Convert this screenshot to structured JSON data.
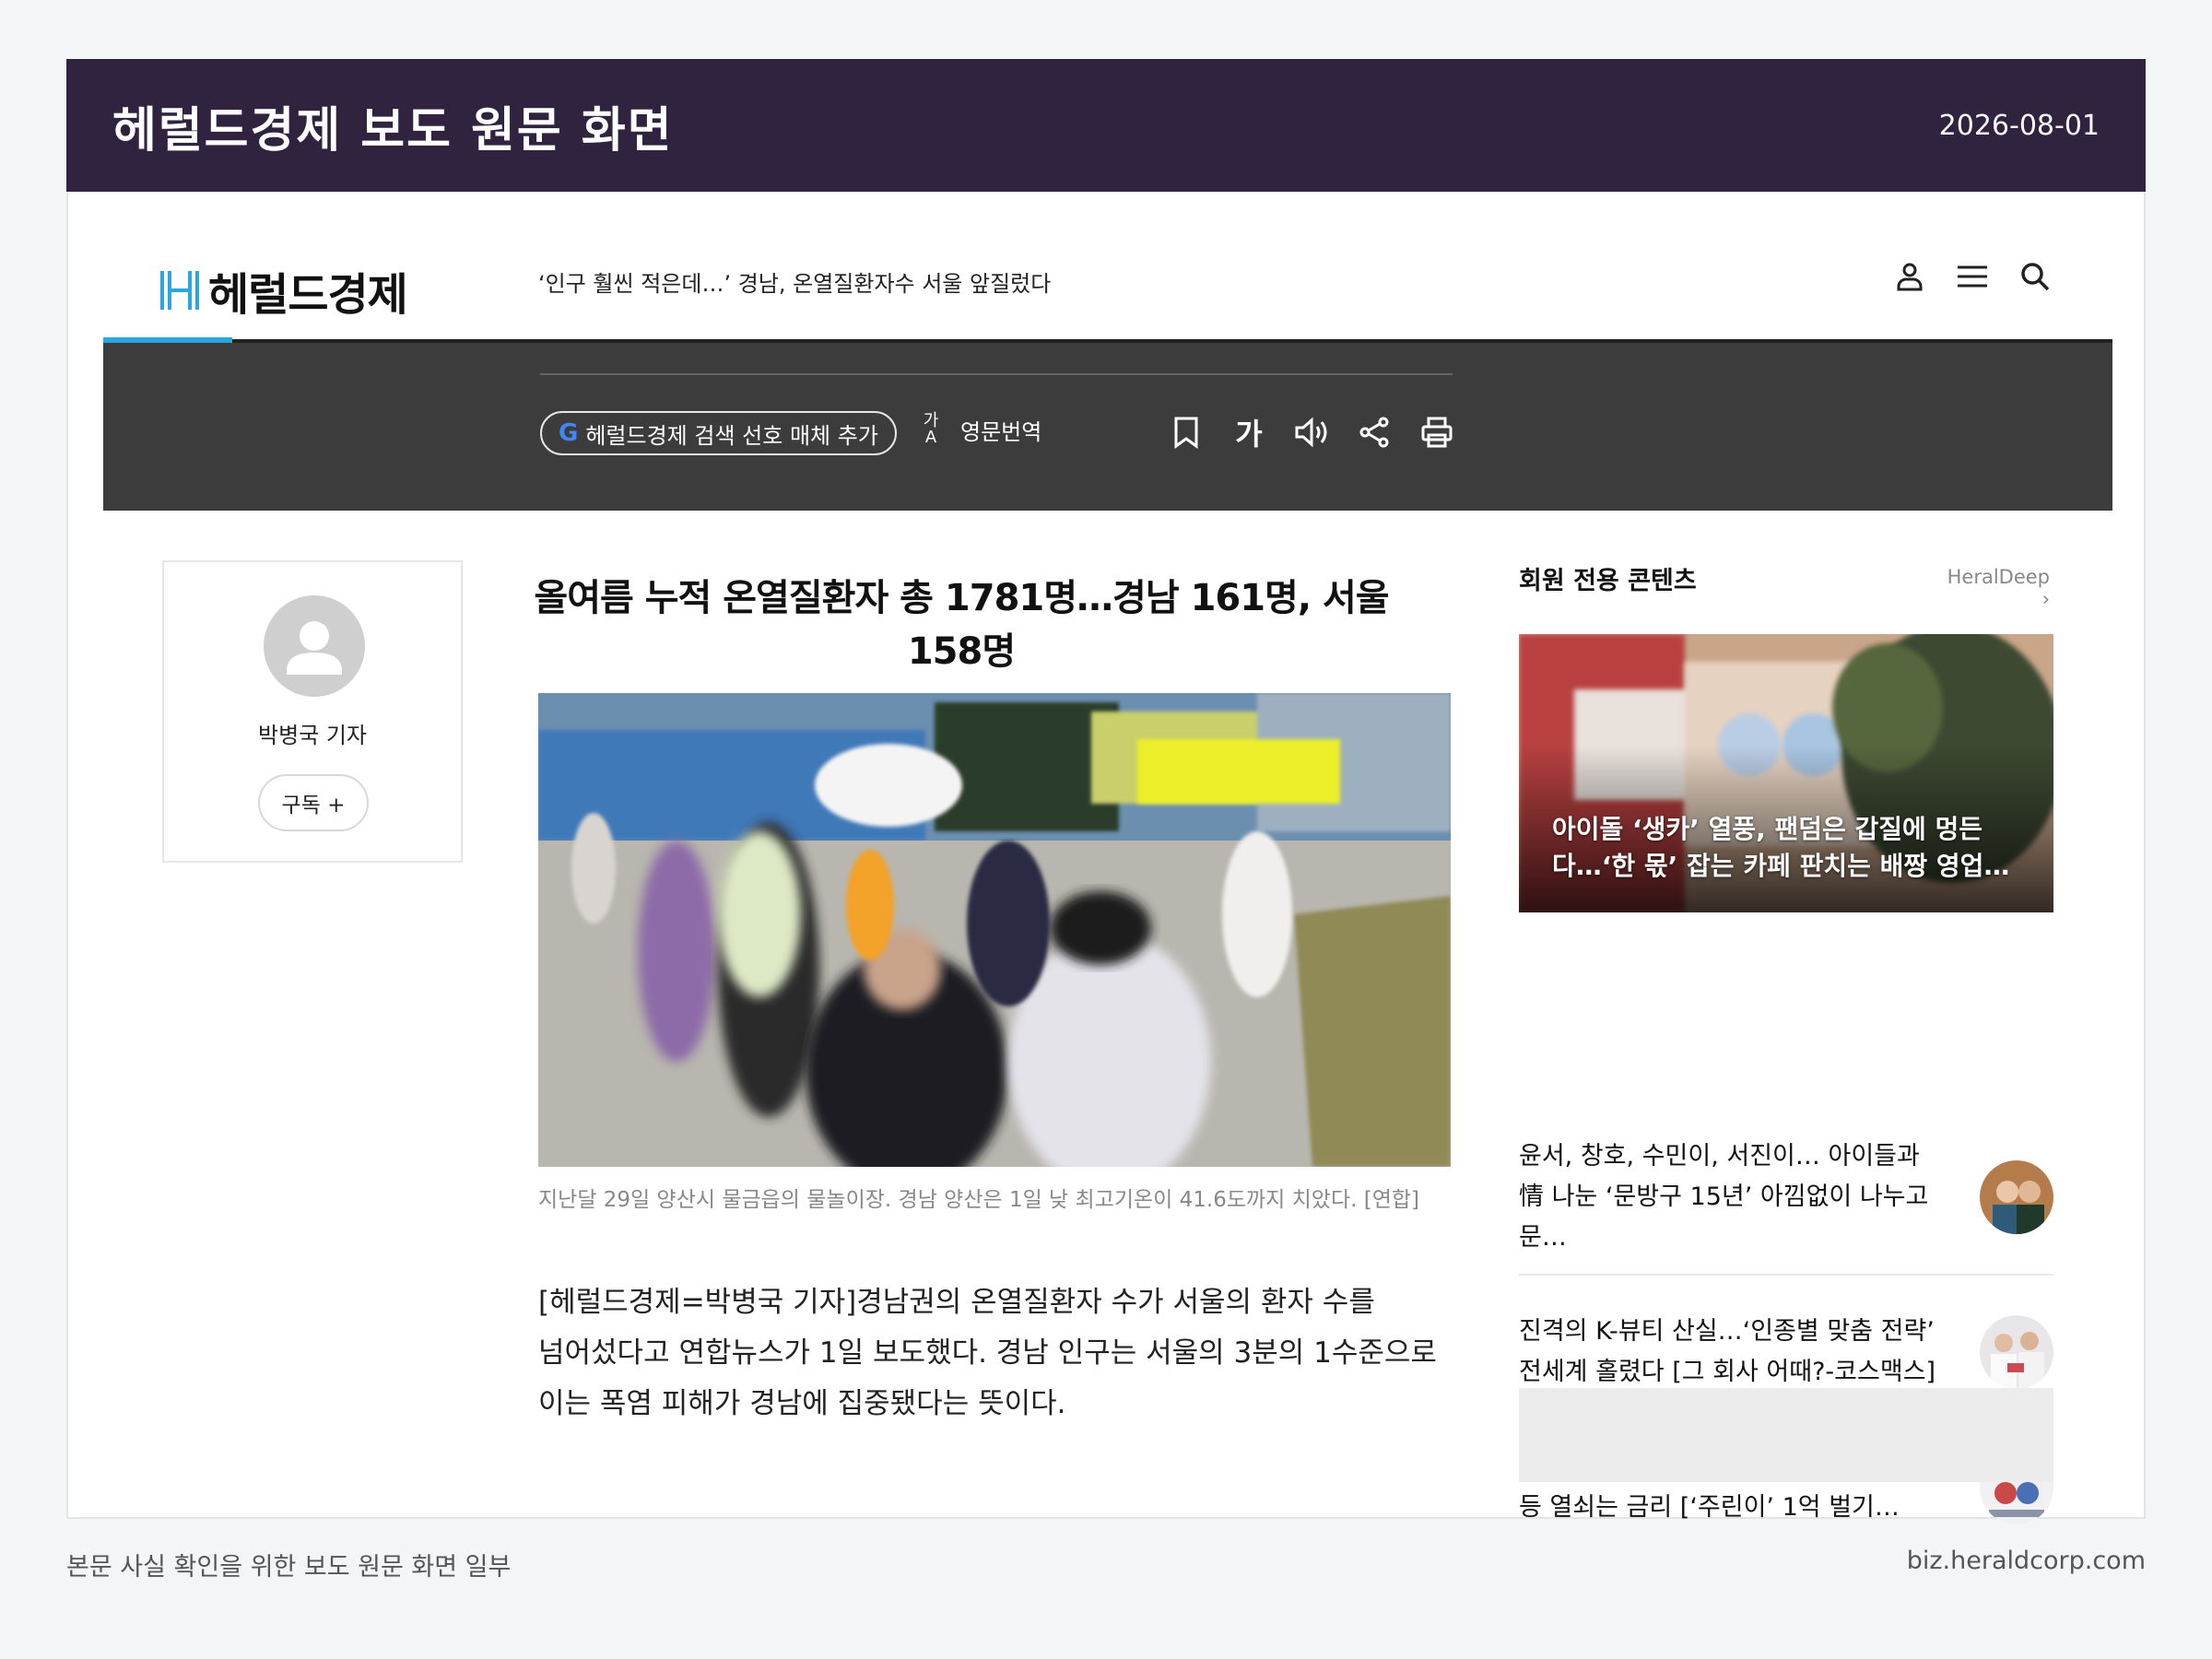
{
  "top_bar": {
    "title": "헤럴드경제 보도 원문 화면",
    "date": "2026-08-01"
  },
  "site": {
    "logo_text": "헤럴드경제",
    "ticker": "‘인구 훨씬 적은데…’ 경남, 온열질환자수 서울 앞질렀다",
    "icons": [
      "user-icon",
      "menu-icon",
      "search-icon"
    ]
  },
  "toolbar": {
    "pref_logo": "G",
    "pref_label": "헤럴드경제 검색 선호 매체 추가",
    "translate_icon_top": "가",
    "translate_icon_bottom": "A",
    "translate_label": "영문번역",
    "font_size_label": "가",
    "icons": [
      "bookmark-icon",
      "font-size-icon",
      "speaker-icon",
      "share-icon",
      "print-icon"
    ]
  },
  "reporter": {
    "name": "박병국 기자",
    "subscribe_label": "구독 +"
  },
  "article": {
    "title": "올여름 누적 온열질환자 총 1781명…경남 161명, 서울 158명",
    "caption": "지난달 29일 양산시 물금읍의 물놀이장. 경남 양산은 1일 낮 최고기온이 41.6도까지 치았다. [연합]",
    "body_lines": [
      "[헤럴드경제=박병국 기자]경남권의 온열질환자 수가 서울의 환자 수를",
      "넘어섰다고 연합뉴스가 1일 보도했다. 경남 인구는 서울의 3분의 1수준으로",
      "이는 폭염 피해가 경남에 집중됐다는 뜻이다."
    ]
  },
  "sidebar": {
    "heading": "회원 전용 콘텐츠",
    "more_label": "HeralDeep ›",
    "feature_text": "아이돌 ‘생카’ 열풍, 팬덤은 갑질에 멍든다…‘한 몫’ 잡는 카페 판치는 배짱 영업…",
    "items": [
      {
        "text": "윤서, 창호, 수민이, 서진이… 아이들과 情 나눈 ‘문방구 15년’ 아낌없이 나누고 문…"
      },
      {
        "text": "진격의 K-뷰티 산실…‘인종별 맞춤 전략’ 전세계 홀렸다 [그 회사 어때?-코스맥스]"
      },
      {
        "text": "왜 미국 국채 10년물이 중요해?…주가 반등 열쇠는 금리 [‘주린이’ 1억 벌기…"
      }
    ]
  },
  "footer": {
    "left": "본문 사실 확인을 위한 보도 원문 화면 일부",
    "right": "biz.heraldcorp.com"
  },
  "colors": {
    "top_bar": "#30233f",
    "toolbar": "#3c3c3c",
    "accent": "#2aa7e0"
  }
}
